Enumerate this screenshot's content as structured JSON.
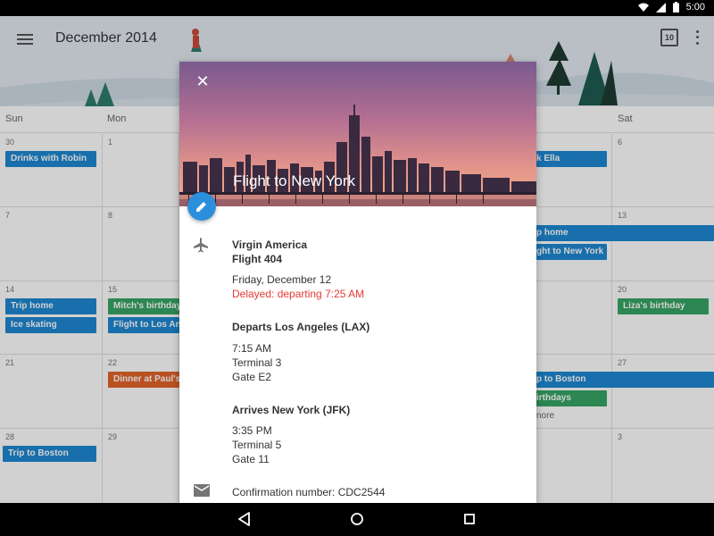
{
  "status_bar": {
    "time": "5:00"
  },
  "app_bar": {
    "month_title": "December 2014",
    "today_number": "10"
  },
  "calendar": {
    "weekdays": [
      "Sun",
      "Mon",
      "Sat"
    ],
    "dates": {
      "r1": [
        "30",
        "1",
        "6"
      ],
      "r2": [
        "7",
        "8",
        "13"
      ],
      "r3": [
        "14",
        "15",
        "20"
      ],
      "r4": [
        "21",
        "22",
        "27"
      ],
      "r5": [
        "28",
        "29",
        "3"
      ]
    },
    "events": {
      "drinks": "Drinks with Robin",
      "ella": "k Ella",
      "trip_home_r2": "p home",
      "flight_ny": "ght to New York",
      "trip_home_r3": "Trip home",
      "ice_skating": "Ice skating",
      "mitchs_birthday": "Mitch's birthday",
      "flight_la": "Flight to Los An",
      "lizas_birthday": "Liza's birthday",
      "dinner": "Dinner at Paul's",
      "trip_boston_r4": "p to Boston",
      "birthdays": "irthdays",
      "more": "nore",
      "trip_boston_r5": "Trip to Boston"
    }
  },
  "card": {
    "title": "Flight to New York",
    "airline": "Virgin America",
    "flight": "Flight 404",
    "date": "Friday, December 12",
    "delay": "Delayed: departing 7:25 AM",
    "depart_header": "Departs Los Angeles (LAX)",
    "depart_time": "7:15 AM",
    "depart_terminal": "Terminal 3",
    "depart_gate": "Gate E2",
    "arrive_header": "Arrives New York (JFK)",
    "arrive_time": "3:35 PM",
    "arrive_terminal": "Terminal 5",
    "arrive_gate": "Gate 11",
    "confirmation": "Confirmation number: CDC2544"
  },
  "colors": {
    "event_blue": "#1e88d2",
    "event_green": "#36a565",
    "event_orange": "#e2632a",
    "delay_red": "#e53935",
    "fab_blue": "#2b8fdc"
  },
  "icons": [
    "menu-icon",
    "today-icon",
    "more-vert-icon",
    "close-icon",
    "edit-icon",
    "flight-icon",
    "email-icon",
    "wifi-icon",
    "signal-icon",
    "battery-icon",
    "back-icon",
    "home-icon",
    "recents-icon"
  ]
}
